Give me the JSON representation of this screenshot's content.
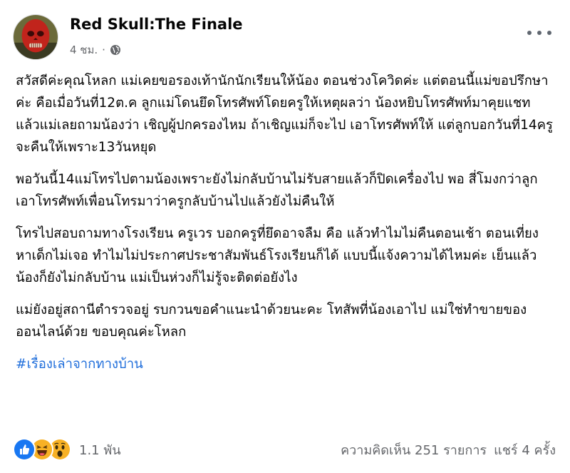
{
  "post": {
    "author": "Red Skull:The Finale",
    "time": "4 ชม.",
    "separator": "·",
    "paragraphs": [
      "สวัสดีค่ะคุณโหลก แม่เคยขอรองเท้านักนักเรียนให้น้อง ตอนช่วงโควิดค่ะ แต่ตอนนี้แม่ขอปรึกษาค่ะ คือเมื่อวันที่12ต.ค ลูกแม่โดนยึดโทรศัพท์โดยครูให้เหตุผลว่า น้องหยิบโทรศัพท์มาคุยแชท แล้วแม่เลยถามน้องว่า เชิญผู้ปกครองไหม ถ้าเชิญแม่ก็จะไป เอาโทรศัพท์ให้ แต่ลูกบอกวันที่14ครูจะคืนให้เพราะ13วันหยุด",
      "พอวันนี้14แม่โทรไปตามน้องเพราะยังไม่กลับบ้านไม่รับสายแล้วก็ปิดเครื่องไป พอ สี่โมงกว่าลูกเอาโทรศัพท์เพื่อนโทรมาว่าครูกลับบ้านไปแล้วยังไม่คืนให้",
      "โทรไปสอบถามทางโรงเรียน ครูเวร บอกครูที่ยึดอาจลืม คือ แล้วทำไมไม่คืนตอนเช้า ตอนเที่ยงหาเด็กไม่เจอ ทำไมไม่ประกาศประชาสัมพันธ์โรงเรียนก็ได้ แบบนี้แจ้งความได้ไหมค่ะ เย็นแล้วน้องก็ยังไม่กลับบ้าน แม่เป็นห่วงก็ไม่รู้จะติดต่อยังไง",
      "แม่ยังอยู่สถานีตำรวจอยู่ รบกวนขอคำแนะนำด้วยนะคะ โทสัพที่น้องเอาไป แม่ใช่ทำขายของออนไลน์ด้วย ขอบคุณค่ะโหลก"
    ],
    "hashtag": "#เรื่องเล่าจากทางบ้าน",
    "reactions": {
      "icons": [
        "like-icon",
        "haha-icon",
        "wow-icon"
      ],
      "count": "1.1 พัน"
    },
    "comments": "ความคิดเห็น 251 รายการ",
    "shares": "แชร์ 4 ครั้ง"
  },
  "colors": {
    "link": "#216fdb",
    "meta": "#65676b",
    "like": "#1877f2",
    "emoji": "#f7b125"
  }
}
